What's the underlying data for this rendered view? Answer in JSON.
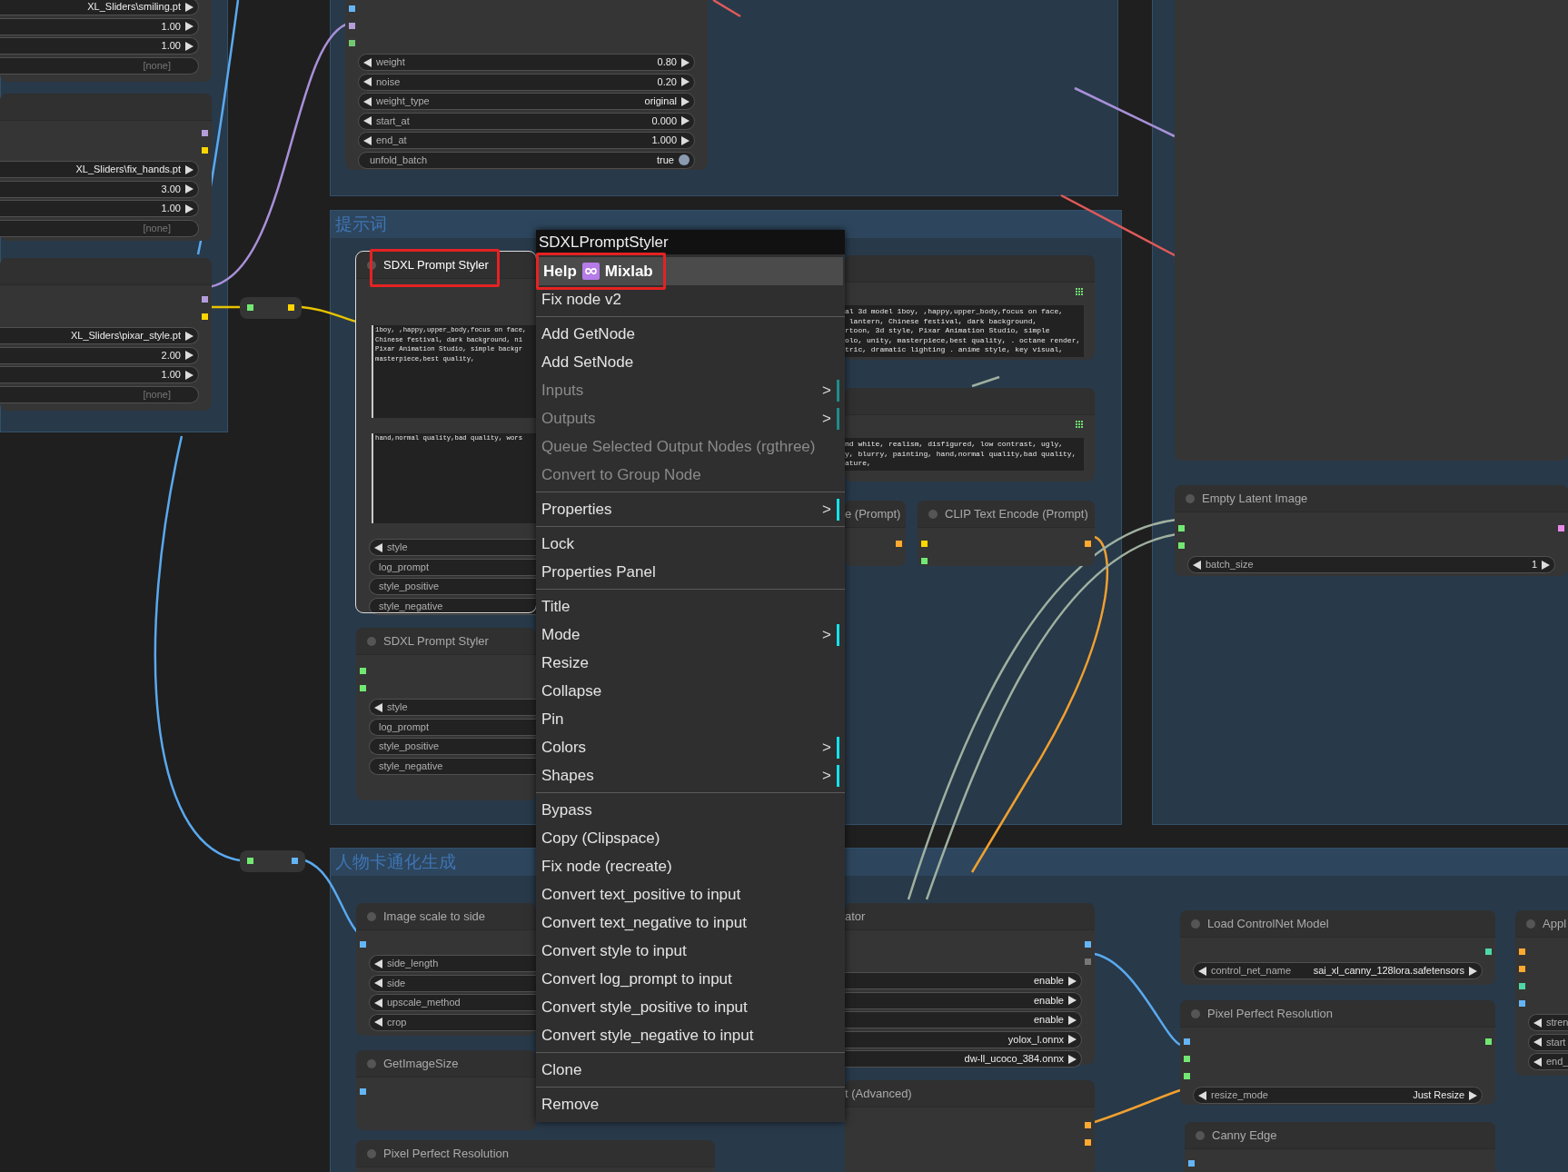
{
  "groups": [
    {
      "title": "提示词"
    },
    {
      "title": "人物卡通化生成"
    }
  ],
  "nodes": [
    {
      "widgets": [
        {
          "kind": "cut-left",
          "value": "XL_Sliders\\smiling.pt"
        },
        {
          "kind": "cut-left",
          "value": "1.00"
        },
        {
          "kind": "cut-left",
          "value": "1.00"
        },
        {
          "kind": "empty",
          "value": "[none]"
        }
      ]
    },
    {
      "out": [
        {
          "color": "#b39ddb"
        },
        {
          "color": "#ffd500"
        }
      ],
      "widgets": [
        {
          "kind": "cut-left",
          "value": "XL_Sliders\\fix_hands.pt"
        },
        {
          "kind": "cut-left",
          "value": "3.00"
        },
        {
          "kind": "cut-left",
          "value": "1.00"
        },
        {
          "kind": "empty",
          "value": "[none]"
        }
      ]
    },
    {
      "out": [
        {
          "color": "#b39ddb"
        },
        {
          "color": "#ffd500"
        }
      ],
      "widgets": [
        {
          "kind": "cut-left",
          "value": "XL_Sliders\\pixar_style.pt"
        },
        {
          "kind": "cut-left",
          "value": "2.00"
        },
        {
          "kind": "cut-left",
          "value": "1.00"
        },
        {
          "kind": "empty",
          "value": "[none]"
        }
      ]
    },
    {
      "kind": "reroute",
      "in": [
        {
          "color": "#72e872"
        }
      ],
      "out": [
        {
          "color": "#ffd500"
        }
      ]
    },
    {
      "kind": "reroute",
      "in": [
        {
          "color": "#72e872"
        }
      ],
      "out": [
        {
          "color": "#64b5f6"
        }
      ]
    },
    {
      "in": [
        {
          "color": "#64b5f6"
        },
        {
          "color": "#b39ddb"
        },
        {
          "color": "#72c872"
        }
      ],
      "widgets": [
        {
          "kind": "combo",
          "label": "weight",
          "value": "0.80"
        },
        {
          "kind": "combo",
          "label": "noise",
          "value": "0.20"
        },
        {
          "kind": "combo",
          "label": "weight_type",
          "value": "original"
        },
        {
          "kind": "combo",
          "label": "start_at",
          "value": "0.000"
        },
        {
          "kind": "combo",
          "label": "end_at",
          "value": "1.000"
        },
        {
          "kind": "toggle",
          "label": "unfold_batch",
          "value": "true",
          "on": true
        }
      ]
    },
    {
      "title": "SDXL Prompt Styler",
      "selected": true,
      "annotated": true,
      "textareas": [
        "1boy, ,happy,upper_body,focus on face,\nChinese festival, dark background, ni\nPixar Animation Studio, simple backgr\nmasterpiece,best quality,",
        "hand,normal quality,bad quality, wors"
      ],
      "widgets": [
        {
          "kind": "cut-right",
          "label": "style"
        },
        {
          "kind": "plain",
          "label": "log_prompt"
        },
        {
          "kind": "plain",
          "label": "style_positive"
        },
        {
          "kind": "plain",
          "label": "style_negative"
        }
      ]
    },
    {
      "title": "SDXL Prompt Styler",
      "selected": false,
      "annotated": false,
      "in": [
        {
          "color": "#72e872"
        },
        {
          "color": "#72e872"
        }
      ],
      "widgets": [
        {
          "kind": "cut-right",
          "label": "style"
        },
        {
          "kind": "plain",
          "label": "log_prompt"
        },
        {
          "kind": "plain",
          "label": "style_positive"
        },
        {
          "kind": "plain",
          "label": "style_negative"
        }
      ]
    },
    {
      "grid": true,
      "textareas": [
        "al 3d model 1boy, ,happy,upper_body,focus on face,\n lantern, Chinese festival, dark background,\nrtoon, 3d style, Pixar Animation Studio, simple\nolo, unity, masterpiece,best quality, . octane render,\ntric, dramatic lighting . anime style, key visual,"
      ]
    },
    {
      "grid": true,
      "textareas": [
        "nd white, realism, disfigured, low contrast, ugly,\ny, blurry, painting, hand,normal quality,bad quality,\nature,"
      ]
    },
    {
      "title": "e (Prompt)",
      "out": [
        {
          "color": "#ffa931"
        }
      ]
    },
    {
      "title": "CLIP Text Encode (Prompt)",
      "in": [
        {
          "color": "#ffd500"
        },
        {
          "color": "#72e872"
        }
      ],
      "out": [
        {
          "color": "#ffa931"
        }
      ]
    },
    {
      "kind": "panel"
    },
    {
      "title": "Empty Latent Image",
      "in": [
        {
          "color": "#72e872"
        },
        {
          "color": "#72e872"
        }
      ],
      "out": [
        {
          "color": "#e88ae8"
        }
      ],
      "widgets": [
        {
          "kind": "combo",
          "label": "batch_size",
          "value": "1"
        }
      ]
    },
    {
      "title": "Image scale to side",
      "in": [
        {
          "color": "#64b5f6"
        }
      ],
      "widgets": [
        {
          "kind": "cut-right",
          "label": "side_length"
        },
        {
          "kind": "cut-right",
          "label": "side"
        },
        {
          "kind": "cut-right",
          "label": "upscale_method"
        },
        {
          "kind": "cut-right",
          "label": "crop"
        }
      ]
    },
    {
      "title": "GetImageSize",
      "in": [
        {
          "color": "#64b5f6"
        }
      ]
    },
    {
      "title": "Pixel Perfect Resolution"
    },
    {
      "title": "ator",
      "out": [
        {
          "color": "#64b5f6"
        },
        {
          "color": "#777777"
        }
      ],
      "widgets": [
        {
          "kind": "cut-left",
          "value": "enable"
        },
        {
          "kind": "cut-left",
          "value": "enable"
        },
        {
          "kind": "cut-left",
          "value": "enable"
        },
        {
          "kind": "cut-left",
          "value": "yolox_l.onnx"
        },
        {
          "kind": "cut-left",
          "value": "dw-ll_ucoco_384.onnx"
        }
      ]
    },
    {
      "title": "t (Advanced)",
      "out": [
        {
          "color": "#ffa931"
        },
        {
          "color": "#ffa931"
        }
      ]
    },
    {
      "title": "Load ControlNet Model",
      "out": [
        {
          "color": "#4ed8a5"
        }
      ],
      "widgets": [
        {
          "kind": "combo",
          "label": "control_net_name",
          "value": "sai_xl_canny_128lora.safetensors"
        }
      ]
    },
    {
      "title": "Pixel Perfect Resolution",
      "in": [
        {
          "color": "#64b5f6"
        },
        {
          "color": "#72e872"
        },
        {
          "color": "#72e872"
        }
      ],
      "out": [
        {
          "color": "#72e872"
        }
      ],
      "widgets": [
        {
          "kind": "combo",
          "label": "resize_mode",
          "value": "Just Resize"
        }
      ]
    },
    {
      "title": "Canny Edge",
      "in": [
        {
          "color": "#64b5f6"
        }
      ]
    },
    {
      "title": "Appl",
      "in": [
        {
          "color": "#ffa931"
        },
        {
          "color": "#ffa931"
        },
        {
          "color": "#4ed8a5"
        },
        {
          "color": "#64b5f6"
        }
      ],
      "widgets": [
        {
          "kind": "cut-right",
          "label": "stren"
        },
        {
          "kind": "cut-right",
          "label": "start"
        },
        {
          "kind": "cut-right",
          "label": "end_"
        }
      ]
    }
  ],
  "context_menu": {
    "title": "SDXLPromptStyler",
    "sections": [
      [
        {
          "label": "Help",
          "suffix": "Mixlab",
          "kind": "icon",
          "highlighted": true,
          "annotated": true,
          "disabled": false
        },
        {
          "label": "Fix node v2",
          "highlighted": false,
          "annotated": false,
          "disabled": false
        }
      ],
      [
        {
          "label": "Add GetNode",
          "highlighted": false,
          "annotated": false,
          "disabled": false
        },
        {
          "label": "Add SetNode",
          "highlighted": false,
          "annotated": false,
          "disabled": false
        },
        {
          "label": "Inputs",
          "arrow": ">",
          "highlighted": false,
          "annotated": false,
          "disabled": true
        },
        {
          "label": "Outputs",
          "arrow": ">",
          "highlighted": false,
          "annotated": false,
          "disabled": true
        },
        {
          "label": "Queue Selected Output Nodes (rgthree)",
          "highlighted": false,
          "annotated": false,
          "disabled": true
        },
        {
          "label": "Convert to Group Node",
          "highlighted": false,
          "annotated": false,
          "disabled": true
        }
      ],
      [
        {
          "label": "Properties",
          "arrow": ">",
          "highlighted": false,
          "annotated": false,
          "disabled": false
        }
      ],
      [
        {
          "label": "Lock",
          "highlighted": false,
          "annotated": false,
          "disabled": false
        },
        {
          "label": "Properties Panel",
          "highlighted": false,
          "annotated": false,
          "disabled": false
        }
      ],
      [
        {
          "label": "Title",
          "highlighted": false,
          "annotated": false,
          "disabled": false
        },
        {
          "label": "Mode",
          "arrow": ">",
          "highlighted": false,
          "annotated": false,
          "disabled": false
        },
        {
          "label": "Resize",
          "highlighted": false,
          "annotated": false,
          "disabled": false
        },
        {
          "label": "Collapse",
          "highlighted": false,
          "annotated": false,
          "disabled": false
        },
        {
          "label": "Pin",
          "highlighted": false,
          "annotated": false,
          "disabled": false
        },
        {
          "label": "Colors",
          "arrow": ">",
          "highlighted": false,
          "annotated": false,
          "disabled": false
        },
        {
          "label": "Shapes",
          "arrow": ">",
          "highlighted": false,
          "annotated": false,
          "disabled": false
        }
      ],
      [
        {
          "label": "Bypass",
          "highlighted": false,
          "annotated": false,
          "disabled": false
        },
        {
          "label": "Copy (Clipspace)",
          "highlighted": false,
          "annotated": false,
          "disabled": false
        },
        {
          "label": "Fix node (recreate)",
          "highlighted": false,
          "annotated": false,
          "disabled": false
        },
        {
          "label": "Convert text_positive to input",
          "highlighted": false,
          "annotated": false,
          "disabled": false
        },
        {
          "label": "Convert text_negative to input",
          "highlighted": false,
          "annotated": false,
          "disabled": false
        },
        {
          "label": "Convert style to input",
          "highlighted": false,
          "annotated": false,
          "disabled": false
        },
        {
          "label": "Convert log_prompt to input",
          "highlighted": false,
          "annotated": false,
          "disabled": false
        },
        {
          "label": "Convert style_positive to input",
          "highlighted": false,
          "annotated": false,
          "disabled": false
        },
        {
          "label": "Convert style_negative to input",
          "highlighted": false,
          "annotated": false,
          "disabled": false
        }
      ],
      [
        {
          "label": "Clone",
          "highlighted": false,
          "annotated": false,
          "disabled": false
        }
      ],
      [
        {
          "label": "Remove",
          "highlighted": false,
          "annotated": false,
          "disabled": false
        }
      ]
    ]
  }
}
